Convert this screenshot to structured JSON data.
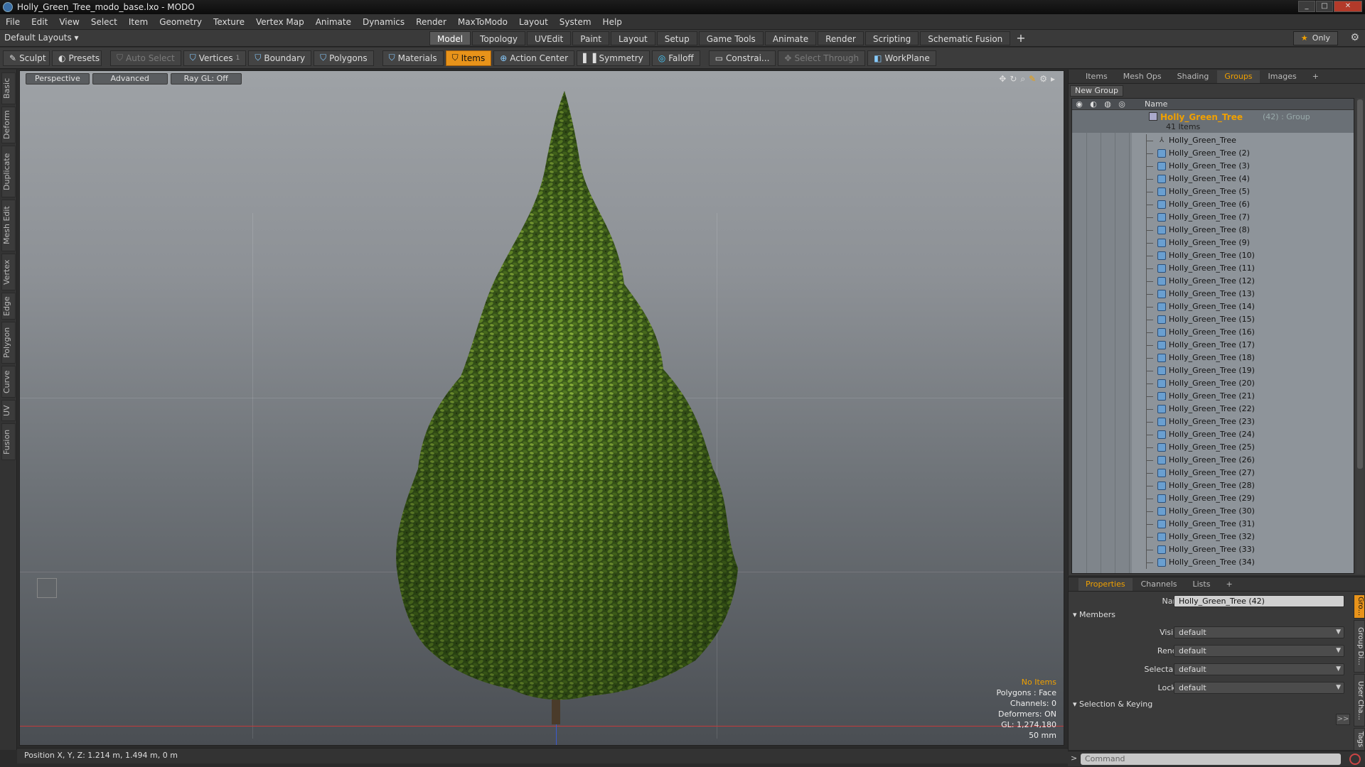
{
  "window": {
    "title": "Holly_Green_Tree_modo_base.lxo - MODO"
  },
  "menu": [
    "File",
    "Edit",
    "View",
    "Select",
    "Item",
    "Geometry",
    "Texture",
    "Vertex Map",
    "Animate",
    "Dynamics",
    "Render",
    "MaxToModo",
    "Layout",
    "System",
    "Help"
  ],
  "layout_selector": "Default Layouts ▾",
  "layout_tabs": [
    "Model",
    "Topology",
    "UVEdit",
    "Paint",
    "Layout",
    "Setup",
    "Game Tools",
    "Animate",
    "Render",
    "Scripting",
    "Schematic Fusion"
  ],
  "only_label": "Only",
  "toolbar": {
    "sculpt": "Sculpt",
    "presets": "Presets",
    "auto_select": "Auto Select",
    "vertices": "Vertices",
    "vertices_count": "1",
    "boundary": "Boundary",
    "polygons": "Polygons",
    "materials": "Materials",
    "items": "Items",
    "action_center": "Action Center",
    "symmetry": "Symmetry",
    "falloff": "Falloff",
    "constraints": "Constrai...",
    "select_through": "Select Through",
    "workplane": "WorkPlane"
  },
  "left_tabs": [
    "Basic",
    "Deform",
    "Duplicate",
    "Mesh Edit",
    "Vertex",
    "Edge",
    "Polygon",
    "Curve",
    "UV",
    "Fusion"
  ],
  "viewport": {
    "perspective": "Perspective",
    "advanced": "Advanced",
    "raygl": "Ray GL: Off",
    "hud": {
      "no_items": "No Items",
      "polygons": "Polygons : Face",
      "channels": "Channels: 0",
      "deformers": "Deformers: ON",
      "gl": "GL: 1,274,180",
      "focal": "50 mm"
    }
  },
  "status": "Position X, Y, Z:  1.214 m, 1.494 m, 0 m",
  "right_tabs": [
    "Items",
    "Mesh Ops",
    "Shading",
    "Groups",
    "Images"
  ],
  "new_group": "New Group",
  "list_header": "Name",
  "group": {
    "name": "Holly_Green_Tree",
    "suffix": "(42) : Group",
    "count": "41 Items"
  },
  "items": [
    "Holly_Green_Tree",
    "Holly_Green_Tree (2)",
    "Holly_Green_Tree (3)",
    "Holly_Green_Tree (4)",
    "Holly_Green_Tree (5)",
    "Holly_Green_Tree (6)",
    "Holly_Green_Tree (7)",
    "Holly_Green_Tree (8)",
    "Holly_Green_Tree (9)",
    "Holly_Green_Tree (10)",
    "Holly_Green_Tree (11)",
    "Holly_Green_Tree (12)",
    "Holly_Green_Tree (13)",
    "Holly_Green_Tree (14)",
    "Holly_Green_Tree (15)",
    "Holly_Green_Tree (16)",
    "Holly_Green_Tree (17)",
    "Holly_Green_Tree (18)",
    "Holly_Green_Tree (19)",
    "Holly_Green_Tree (20)",
    "Holly_Green_Tree (21)",
    "Holly_Green_Tree (22)",
    "Holly_Green_Tree (23)",
    "Holly_Green_Tree (24)",
    "Holly_Green_Tree (25)",
    "Holly_Green_Tree (26)",
    "Holly_Green_Tree (27)",
    "Holly_Green_Tree (28)",
    "Holly_Green_Tree (29)",
    "Holly_Green_Tree (30)",
    "Holly_Green_Tree (31)",
    "Holly_Green_Tree (32)",
    "Holly_Green_Tree (33)",
    "Holly_Green_Tree (34)"
  ],
  "props_tabs": [
    "Properties",
    "Channels",
    "Lists"
  ],
  "props": {
    "name_label": "Name",
    "name_value": "Holly_Green_Tree (42)",
    "members": "Members",
    "visible_label": "Visible",
    "visible_value": "default",
    "render_label": "Render",
    "render_value": "default",
    "selectable_label": "Selectable",
    "selectable_value": "default",
    "locked_label": "Locked",
    "locked_value": "default",
    "selection_keying": "Selection & Keying"
  },
  "side_tabs": [
    "Gro...",
    "Group Di...",
    "User Cha...",
    "Tags"
  ],
  "command_placeholder": "Command",
  "colors": {
    "accent": "#e8931a",
    "tree_dark": "#2f4a16",
    "tree_light": "#6f9a2c"
  }
}
